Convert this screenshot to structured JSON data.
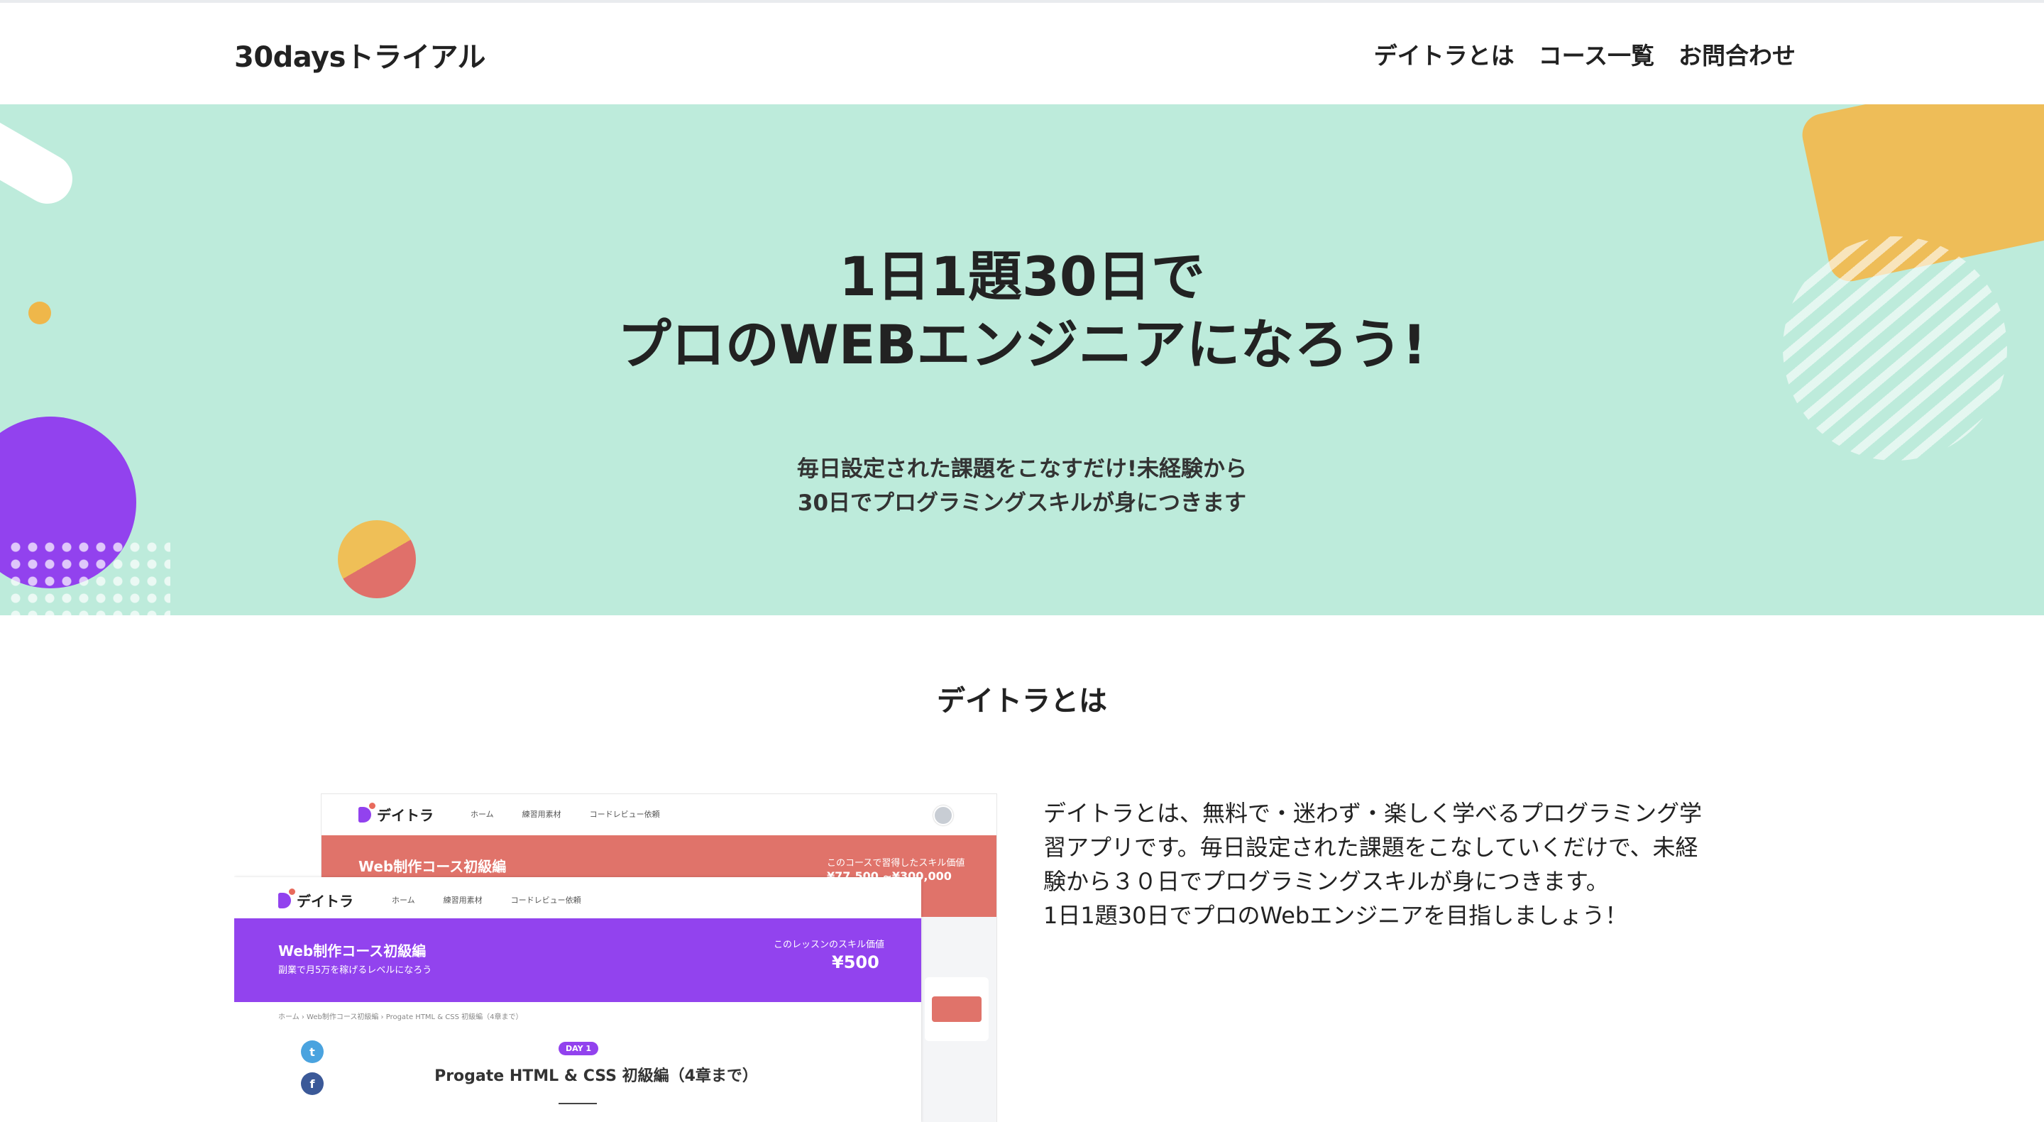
{
  "header": {
    "logo": "30daysトライアル",
    "nav": [
      "デイトラとは",
      "コース一覧",
      "お問合わせ"
    ]
  },
  "hero": {
    "title_line1": "1日1題30日で",
    "title_line2": "プロのWEBエンジニアになろう!",
    "sub_line1": "毎日設定された課題をこなすだけ!未経験から",
    "sub_line2": "30日でプログラミングスキルが身につきます",
    "colors": {
      "background": "#bdebdb",
      "purple": "#9242ee",
      "yellow": "#eebd58",
      "coral": "#e0736a"
    }
  },
  "about": {
    "heading": "デイトラとは",
    "description_line1": "デイトラとは、無料で・迷わず・楽しく学べるプログラミング学習アプリです。毎日設定された課題をこなしていくだけで、未経験から３０日でプログラミングスキルが身につきます。",
    "description_line2": "1日1題30日でプロのWebエンジニアを目指しましょう！"
  },
  "screenshot_back": {
    "logo": "デイトラ",
    "nav": [
      "ホーム",
      "練習用素材",
      "コードレビュー依頼"
    ],
    "banner_title": "Web制作コース初級編",
    "banner_label": "このコースで習得したスキル価値",
    "banner_price": "¥77,500 ~¥300,000"
  },
  "screenshot_front": {
    "logo": "デイトラ",
    "nav": [
      "ホーム",
      "練習用素材",
      "コードレビュー依頼"
    ],
    "banner_title": "Web制作コース初級編",
    "banner_sub": "副業で月5万を稼げるレベルになろう",
    "banner_label": "このレッスンのスキル価値",
    "banner_price": "¥500",
    "breadcrumb": "ホーム  ›  Web制作コース初級編  ›  Progate HTML & CSS 初級編（4章まで）",
    "day_badge": "DAY 1",
    "lesson_title": "Progate HTML & CSS 初級編（4章まで）",
    "social": [
      "twitter-icon",
      "facebook-icon"
    ]
  }
}
